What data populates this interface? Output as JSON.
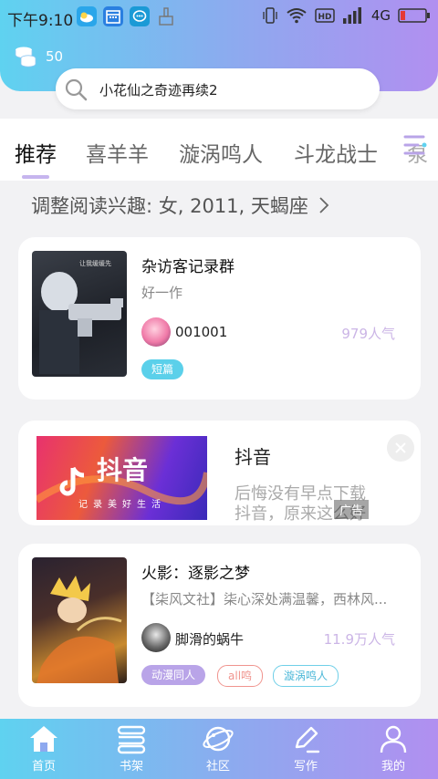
{
  "status": {
    "time": "下午9:10",
    "network": "4G"
  },
  "coins": {
    "count": "50"
  },
  "search": {
    "query": "小花仙之奇迹再续2"
  },
  "tabs": [
    {
      "label": "推荐"
    },
    {
      "label": "喜羊羊"
    },
    {
      "label": "漩涡鸣人"
    },
    {
      "label": "斗龙战士"
    },
    {
      "label": "泵"
    }
  ],
  "preference": {
    "text": "调整阅读兴趣: 女, 2011, 天蝎座"
  },
  "books": [
    {
      "title": "杂访客记录群",
      "desc": "好一作",
      "author": "001001",
      "popularity": "979人气",
      "tags": [
        "短篇"
      ]
    },
    {
      "title": "火影：逐影之梦",
      "desc": "【柒风文社】柒心深处满温馨，西林风...",
      "author": "脚滑的蜗牛",
      "popularity": "11.9万人气",
      "tags": [
        "动漫同人",
        "all鸣",
        "漩涡鸣人"
      ]
    }
  ],
  "ad": {
    "brand_text": "抖音",
    "slogan": "记录美好生活",
    "title": "抖音",
    "desc_line1": "后悔没有早点下载",
    "desc_line2": "抖音，原来这么好",
    "badge": "广告"
  },
  "nav": [
    {
      "label": "首页"
    },
    {
      "label": "书架"
    },
    {
      "label": "社区"
    },
    {
      "label": "写作"
    },
    {
      "label": "我的"
    }
  ],
  "colors": {
    "accent_gradient_start": "#5fd2f0",
    "accent_gradient_end": "#b18ff0",
    "tag_short": "#5bd0ea",
    "tag_anime": "#b9a4e8",
    "tag_all": "#f0948e",
    "tag_naruto": "#6fcfe8"
  }
}
